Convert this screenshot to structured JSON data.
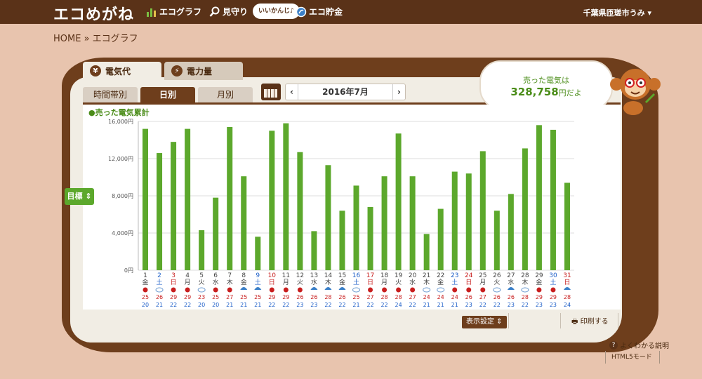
{
  "header": {
    "logo": "エコめがね",
    "nav": [
      {
        "label": "エコグラフ",
        "icon": "bar-chart-icon"
      },
      {
        "label": "見守り",
        "icon": "magnifier-icon"
      },
      {
        "label": "エコ貯金",
        "icon": "coin-icon"
      }
    ],
    "speech": "いいかんじ♪",
    "user": "千葉県匝瑳市うみ ▾"
  },
  "breadcrumb": "HOME » エコグラフ",
  "tabs": {
    "main": [
      {
        "label": "電気代",
        "icon": "yen-icon"
      },
      {
        "label": "電力量",
        "icon": "lightning-icon"
      }
    ],
    "sub": [
      "時間帯別",
      "日別",
      "月別"
    ]
  },
  "month_selector": {
    "label": "2016年7月",
    "prev": "‹",
    "next": "›"
  },
  "bubble": {
    "line1": "売った電気は",
    "amount": "328,758",
    "suffix": "円だよ"
  },
  "goal_button": "目標 ⇕",
  "buttons": {
    "display_settings": "表示設定 ⇕",
    "print": "印刷する"
  },
  "help_link": "よくわかる説明",
  "html5_mode": "HTML5モード",
  "colors": {
    "bar": "#5ca82c",
    "grid": "#dddddd",
    "red": "#c81e1e",
    "blue": "#1e5fc8",
    "brown": "#5a3218"
  },
  "chart_data": {
    "type": "bar",
    "title": "●売った電気累計",
    "yticks": [
      "0円",
      "4,000円",
      "8,000円",
      "12,000円",
      "16,000円"
    ],
    "ylim": [
      0,
      16000
    ],
    "days": [
      1,
      2,
      3,
      4,
      5,
      6,
      7,
      8,
      9,
      10,
      11,
      12,
      13,
      14,
      15,
      16,
      17,
      18,
      19,
      20,
      21,
      22,
      23,
      24,
      25,
      26,
      27,
      28,
      29,
      30,
      31
    ],
    "weekdays": [
      "金",
      "土",
      "日",
      "月",
      "火",
      "水",
      "木",
      "金",
      "土",
      "日",
      "月",
      "火",
      "水",
      "木",
      "金",
      "土",
      "日",
      "月",
      "火",
      "水",
      "木",
      "金",
      "土",
      "日",
      "月",
      "火",
      "水",
      "木",
      "金",
      "土",
      "日"
    ],
    "values": [
      15200,
      12600,
      13800,
      15200,
      4300,
      7800,
      15400,
      10100,
      3600,
      15000,
      15800,
      12700,
      4200,
      11300,
      6400,
      9100,
      6800,
      10100,
      14700,
      10100,
      3900,
      6600,
      10600,
      10400,
      12800,
      6400,
      8200,
      13100,
      15600,
      15100,
      9400
    ],
    "high_temps": [
      25,
      26,
      29,
      29,
      23,
      25,
      27,
      25,
      25,
      29,
      29,
      26,
      26,
      28,
      26,
      25,
      27,
      28,
      28,
      27,
      24,
      24,
      24,
      26,
      27,
      26,
      26,
      28,
      29,
      29,
      28
    ],
    "low_temps": [
      20,
      21,
      22,
      22,
      20,
      20,
      21,
      21,
      21,
      22,
      22,
      23,
      23,
      22,
      22,
      21,
      22,
      22,
      24,
      22,
      21,
      21,
      21,
      23,
      22,
      22,
      23,
      22,
      23,
      23,
      24
    ],
    "weather": [
      "sun",
      "cloud",
      "sun",
      "sun",
      "cloud",
      "sun",
      "sun",
      "rain",
      "rain",
      "sun",
      "sun",
      "sun",
      "rain",
      "rain",
      "rain",
      "cloud",
      "sun",
      "sun",
      "sun",
      "sun",
      "cloud",
      "cloud",
      "sun",
      "sun",
      "sun",
      "cloud",
      "rain",
      "cloud",
      "sun",
      "sun",
      "rain"
    ]
  }
}
